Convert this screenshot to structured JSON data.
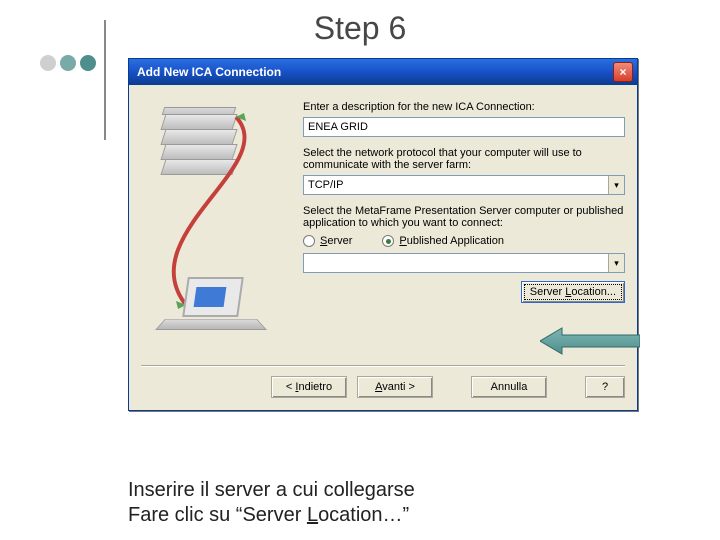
{
  "slide": {
    "title": "Step 6",
    "caption_line1": "Inserire il server a cui collegarse",
    "caption_line2": "Fare clic su “Server Location…”",
    "caption_underline_char": "L"
  },
  "dialog": {
    "title": "Add New ICA Connection",
    "desc_label": "Enter a description for the new ICA Connection:",
    "desc_value": "ENEA GRID",
    "proto_label": "Select the network protocol that your computer will use to communicate with the server farm:",
    "proto_value": "TCP/IP",
    "target_label": "Select the MetaFrame Presentation Server computer or published application to which you want to connect:",
    "radio_server": "Server",
    "radio_pubapp": "Published Application",
    "radio_selected": "pubapp",
    "target_value": "",
    "server_location_btn": "Server Location...",
    "buttons": {
      "back": "< Indietro",
      "next": "Avanti >",
      "cancel": "Annulla",
      "help": "?"
    }
  },
  "icons": {
    "close": "×",
    "dropdown": "▾"
  }
}
